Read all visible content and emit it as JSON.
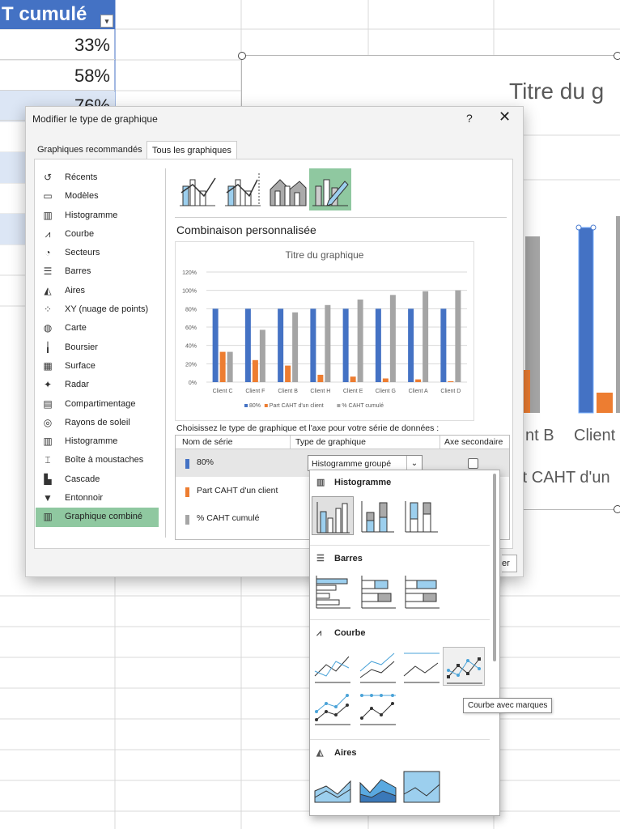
{
  "sheet": {
    "header": "T cumulé",
    "filter_icon": "▾",
    "cells": [
      "33%",
      "58%",
      "76%"
    ]
  },
  "bg_chart": {
    "title": "Titre du g",
    "labels": [
      "nt B",
      "Client"
    ],
    "legend_text": "rt CAHT d'un",
    "colors": {
      "blue": "#4472c4",
      "orange": "#ed7d31",
      "gray": "#a5a5a5"
    }
  },
  "dialog": {
    "title": "Modifier le type de graphique",
    "help": "?",
    "close": "✕",
    "tabs": [
      "Graphiques recommandés",
      "Tous les graphiques"
    ],
    "categories": [
      {
        "label": "Récents",
        "icon": "recent-icon",
        "glyph": "↺"
      },
      {
        "label": "Modèles",
        "icon": "folder-icon",
        "glyph": "▭"
      },
      {
        "label": "Histogramme",
        "icon": "column-chart-icon",
        "glyph": "▥"
      },
      {
        "label": "Courbe",
        "icon": "line-chart-icon",
        "glyph": "⩘"
      },
      {
        "label": "Secteurs",
        "icon": "pie-chart-icon",
        "glyph": "◔"
      },
      {
        "label": "Barres",
        "icon": "bar-chart-icon",
        "glyph": "☰"
      },
      {
        "label": "Aires",
        "icon": "area-chart-icon",
        "glyph": "◭"
      },
      {
        "label": "XY (nuage de points)",
        "icon": "scatter-icon",
        "glyph": "⁘"
      },
      {
        "label": "Carte",
        "icon": "map-icon",
        "glyph": "◍"
      },
      {
        "label": "Boursier",
        "icon": "stock-icon",
        "glyph": "╽"
      },
      {
        "label": "Surface",
        "icon": "surface-icon",
        "glyph": "▦"
      },
      {
        "label": "Radar",
        "icon": "radar-icon",
        "glyph": "✦"
      },
      {
        "label": "Compartimentage",
        "icon": "treemap-icon",
        "glyph": "▤"
      },
      {
        "label": "Rayons de soleil",
        "icon": "sunburst-icon",
        "glyph": "◎"
      },
      {
        "label": "Histogramme",
        "icon": "histogram-icon",
        "glyph": "▥"
      },
      {
        "label": "Boîte à moustaches",
        "icon": "boxplot-icon",
        "glyph": "⌶"
      },
      {
        "label": "Cascade",
        "icon": "waterfall-icon",
        "glyph": "▙"
      },
      {
        "label": "Entonnoir",
        "icon": "funnel-icon",
        "glyph": "▼"
      },
      {
        "label": "Graphique combiné",
        "icon": "combo-chart-icon",
        "glyph": "▥"
      }
    ],
    "section_title": "Combinaison personnalisée",
    "series_instruction": "Choisissez le type de graphique et l'axe pour votre série de données :",
    "table_headers": [
      "Nom de série",
      "Type de graphique",
      "Axe secondaire"
    ],
    "series": [
      {
        "name": "80%",
        "color": "#4472c4",
        "type": "Histogramme groupé"
      },
      {
        "name": "Part CAHT d'un client",
        "color": "#ed7d31"
      },
      {
        "name": "% CAHT cumulé",
        "color": "#a5a5a5"
      }
    ],
    "footer_partial": "er"
  },
  "gallery": {
    "sections": [
      "Histogramme",
      "Barres",
      "Courbe",
      "Aires"
    ],
    "tooltip": "Courbe avec marques"
  },
  "chart_data": {
    "type": "bar",
    "title": "Titre du graphique",
    "categories": [
      "Client C",
      "Client F",
      "Client B",
      "Client H",
      "Client E",
      "Client G",
      "Client A",
      "Client D"
    ],
    "series": [
      {
        "name": "80%",
        "values": [
          80,
          80,
          80,
          80,
          80,
          80,
          80,
          80
        ]
      },
      {
        "name": "Part CAHT d'un client",
        "values": [
          33,
          24,
          18,
          8,
          6,
          4,
          3,
          1
        ]
      },
      {
        "name": "% CAHT cumulé",
        "values": [
          33,
          57,
          76,
          84,
          90,
          95,
          99,
          100
        ]
      }
    ],
    "ylim": [
      0,
      120
    ],
    "yticks": [
      "0%",
      "20%",
      "40%",
      "60%",
      "80%",
      "100%",
      "120%"
    ],
    "grid": true,
    "legend": "bottom"
  }
}
